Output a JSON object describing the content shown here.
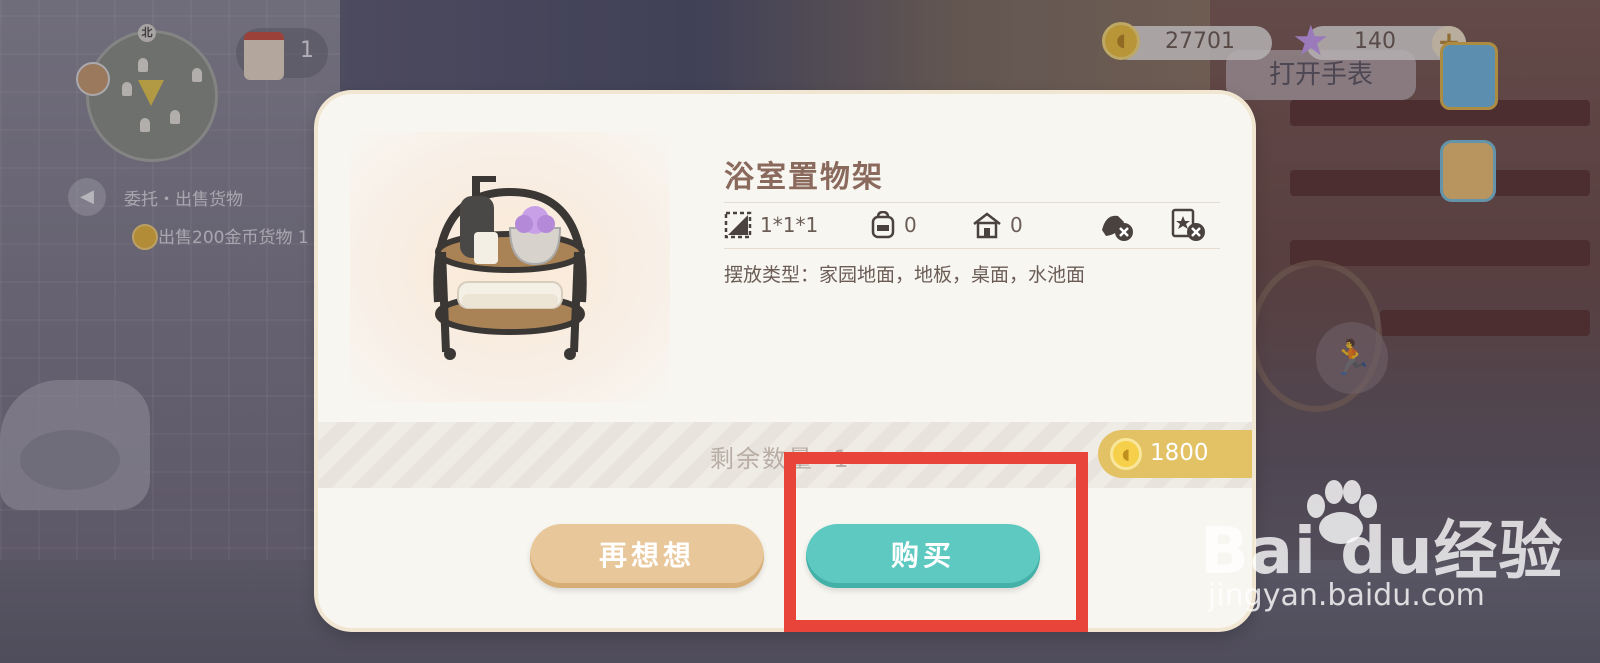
{
  "hud": {
    "minimap": {
      "north_label": "北"
    },
    "calendar": {
      "count": "1"
    },
    "task": {
      "title": "委托・出售货物",
      "subtitle": "出售200金币货物",
      "subtitle_suffix": "1"
    },
    "currency": {
      "coins": "27701",
      "stars": "140",
      "add_label": "+"
    },
    "watch_button_label": "打开手表"
  },
  "dialog": {
    "item_name": "浴室置物架",
    "attributes": [
      {
        "icon": "size-icon",
        "value": "1*1*1"
      },
      {
        "icon": "backpack-icon",
        "value": "0"
      },
      {
        "icon": "house-icon",
        "value": "0"
      },
      {
        "icon": "cleaning-disabled-icon",
        "value": ""
      },
      {
        "icon": "favorite-disabled-icon",
        "value": ""
      }
    ],
    "placement_label": "摆放类型：",
    "placement_types": "家园地面，地板，桌面，水池面",
    "remaining_label": "剩余数量",
    "remaining_value": "1",
    "price": "1800",
    "buttons": {
      "reconsider": "再想想",
      "buy": "购买"
    }
  },
  "highlight": {
    "target": "buy-button",
    "color": "#e9443a"
  },
  "watermark": {
    "logo_text": "Bai  du",
    "logo_suffix": "经验",
    "url": "jingyan.baidu.com"
  },
  "colors": {
    "accent_buy": "#5ec9c0",
    "accent_think": "#e8c79a",
    "price_tag": "#e3c266",
    "title": "#8b6a5e"
  }
}
